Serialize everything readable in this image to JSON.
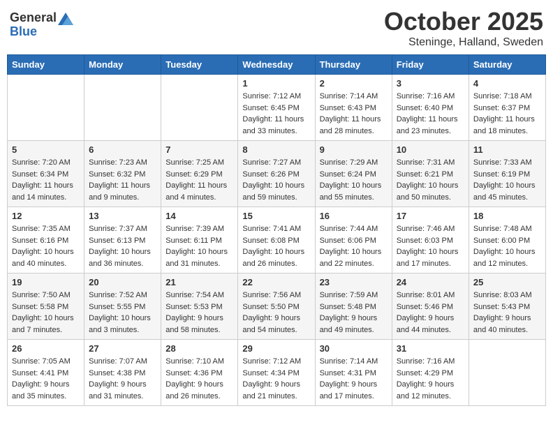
{
  "header": {
    "logo_general": "General",
    "logo_blue": "Blue",
    "month": "October 2025",
    "location": "Steninge, Halland, Sweden"
  },
  "days_of_week": [
    "Sunday",
    "Monday",
    "Tuesday",
    "Wednesday",
    "Thursday",
    "Friday",
    "Saturday"
  ],
  "weeks": [
    [
      {
        "day": "",
        "sunrise": "",
        "sunset": "",
        "daylight": ""
      },
      {
        "day": "",
        "sunrise": "",
        "sunset": "",
        "daylight": ""
      },
      {
        "day": "",
        "sunrise": "",
        "sunset": "",
        "daylight": ""
      },
      {
        "day": "1",
        "sunrise": "Sunrise: 7:12 AM",
        "sunset": "Sunset: 6:45 PM",
        "daylight": "Daylight: 11 hours and 33 minutes."
      },
      {
        "day": "2",
        "sunrise": "Sunrise: 7:14 AM",
        "sunset": "Sunset: 6:43 PM",
        "daylight": "Daylight: 11 hours and 28 minutes."
      },
      {
        "day": "3",
        "sunrise": "Sunrise: 7:16 AM",
        "sunset": "Sunset: 6:40 PM",
        "daylight": "Daylight: 11 hours and 23 minutes."
      },
      {
        "day": "4",
        "sunrise": "Sunrise: 7:18 AM",
        "sunset": "Sunset: 6:37 PM",
        "daylight": "Daylight: 11 hours and 18 minutes."
      }
    ],
    [
      {
        "day": "5",
        "sunrise": "Sunrise: 7:20 AM",
        "sunset": "Sunset: 6:34 PM",
        "daylight": "Daylight: 11 hours and 14 minutes."
      },
      {
        "day": "6",
        "sunrise": "Sunrise: 7:23 AM",
        "sunset": "Sunset: 6:32 PM",
        "daylight": "Daylight: 11 hours and 9 minutes."
      },
      {
        "day": "7",
        "sunrise": "Sunrise: 7:25 AM",
        "sunset": "Sunset: 6:29 PM",
        "daylight": "Daylight: 11 hours and 4 minutes."
      },
      {
        "day": "8",
        "sunrise": "Sunrise: 7:27 AM",
        "sunset": "Sunset: 6:26 PM",
        "daylight": "Daylight: 10 hours and 59 minutes."
      },
      {
        "day": "9",
        "sunrise": "Sunrise: 7:29 AM",
        "sunset": "Sunset: 6:24 PM",
        "daylight": "Daylight: 10 hours and 55 minutes."
      },
      {
        "day": "10",
        "sunrise": "Sunrise: 7:31 AM",
        "sunset": "Sunset: 6:21 PM",
        "daylight": "Daylight: 10 hours and 50 minutes."
      },
      {
        "day": "11",
        "sunrise": "Sunrise: 7:33 AM",
        "sunset": "Sunset: 6:19 PM",
        "daylight": "Daylight: 10 hours and 45 minutes."
      }
    ],
    [
      {
        "day": "12",
        "sunrise": "Sunrise: 7:35 AM",
        "sunset": "Sunset: 6:16 PM",
        "daylight": "Daylight: 10 hours and 40 minutes."
      },
      {
        "day": "13",
        "sunrise": "Sunrise: 7:37 AM",
        "sunset": "Sunset: 6:13 PM",
        "daylight": "Daylight: 10 hours and 36 minutes."
      },
      {
        "day": "14",
        "sunrise": "Sunrise: 7:39 AM",
        "sunset": "Sunset: 6:11 PM",
        "daylight": "Daylight: 10 hours and 31 minutes."
      },
      {
        "day": "15",
        "sunrise": "Sunrise: 7:41 AM",
        "sunset": "Sunset: 6:08 PM",
        "daylight": "Daylight: 10 hours and 26 minutes."
      },
      {
        "day": "16",
        "sunrise": "Sunrise: 7:44 AM",
        "sunset": "Sunset: 6:06 PM",
        "daylight": "Daylight: 10 hours and 22 minutes."
      },
      {
        "day": "17",
        "sunrise": "Sunrise: 7:46 AM",
        "sunset": "Sunset: 6:03 PM",
        "daylight": "Daylight: 10 hours and 17 minutes."
      },
      {
        "day": "18",
        "sunrise": "Sunrise: 7:48 AM",
        "sunset": "Sunset: 6:00 PM",
        "daylight": "Daylight: 10 hours and 12 minutes."
      }
    ],
    [
      {
        "day": "19",
        "sunrise": "Sunrise: 7:50 AM",
        "sunset": "Sunset: 5:58 PM",
        "daylight": "Daylight: 10 hours and 7 minutes."
      },
      {
        "day": "20",
        "sunrise": "Sunrise: 7:52 AM",
        "sunset": "Sunset: 5:55 PM",
        "daylight": "Daylight: 10 hours and 3 minutes."
      },
      {
        "day": "21",
        "sunrise": "Sunrise: 7:54 AM",
        "sunset": "Sunset: 5:53 PM",
        "daylight": "Daylight: 9 hours and 58 minutes."
      },
      {
        "day": "22",
        "sunrise": "Sunrise: 7:56 AM",
        "sunset": "Sunset: 5:50 PM",
        "daylight": "Daylight: 9 hours and 54 minutes."
      },
      {
        "day": "23",
        "sunrise": "Sunrise: 7:59 AM",
        "sunset": "Sunset: 5:48 PM",
        "daylight": "Daylight: 9 hours and 49 minutes."
      },
      {
        "day": "24",
        "sunrise": "Sunrise: 8:01 AM",
        "sunset": "Sunset: 5:46 PM",
        "daylight": "Daylight: 9 hours and 44 minutes."
      },
      {
        "day": "25",
        "sunrise": "Sunrise: 8:03 AM",
        "sunset": "Sunset: 5:43 PM",
        "daylight": "Daylight: 9 hours and 40 minutes."
      }
    ],
    [
      {
        "day": "26",
        "sunrise": "Sunrise: 7:05 AM",
        "sunset": "Sunset: 4:41 PM",
        "daylight": "Daylight: 9 hours and 35 minutes."
      },
      {
        "day": "27",
        "sunrise": "Sunrise: 7:07 AM",
        "sunset": "Sunset: 4:38 PM",
        "daylight": "Daylight: 9 hours and 31 minutes."
      },
      {
        "day": "28",
        "sunrise": "Sunrise: 7:10 AM",
        "sunset": "Sunset: 4:36 PM",
        "daylight": "Daylight: 9 hours and 26 minutes."
      },
      {
        "day": "29",
        "sunrise": "Sunrise: 7:12 AM",
        "sunset": "Sunset: 4:34 PM",
        "daylight": "Daylight: 9 hours and 21 minutes."
      },
      {
        "day": "30",
        "sunrise": "Sunrise: 7:14 AM",
        "sunset": "Sunset: 4:31 PM",
        "daylight": "Daylight: 9 hours and 17 minutes."
      },
      {
        "day": "31",
        "sunrise": "Sunrise: 7:16 AM",
        "sunset": "Sunset: 4:29 PM",
        "daylight": "Daylight: 9 hours and 12 minutes."
      },
      {
        "day": "",
        "sunrise": "",
        "sunset": "",
        "daylight": ""
      }
    ]
  ]
}
